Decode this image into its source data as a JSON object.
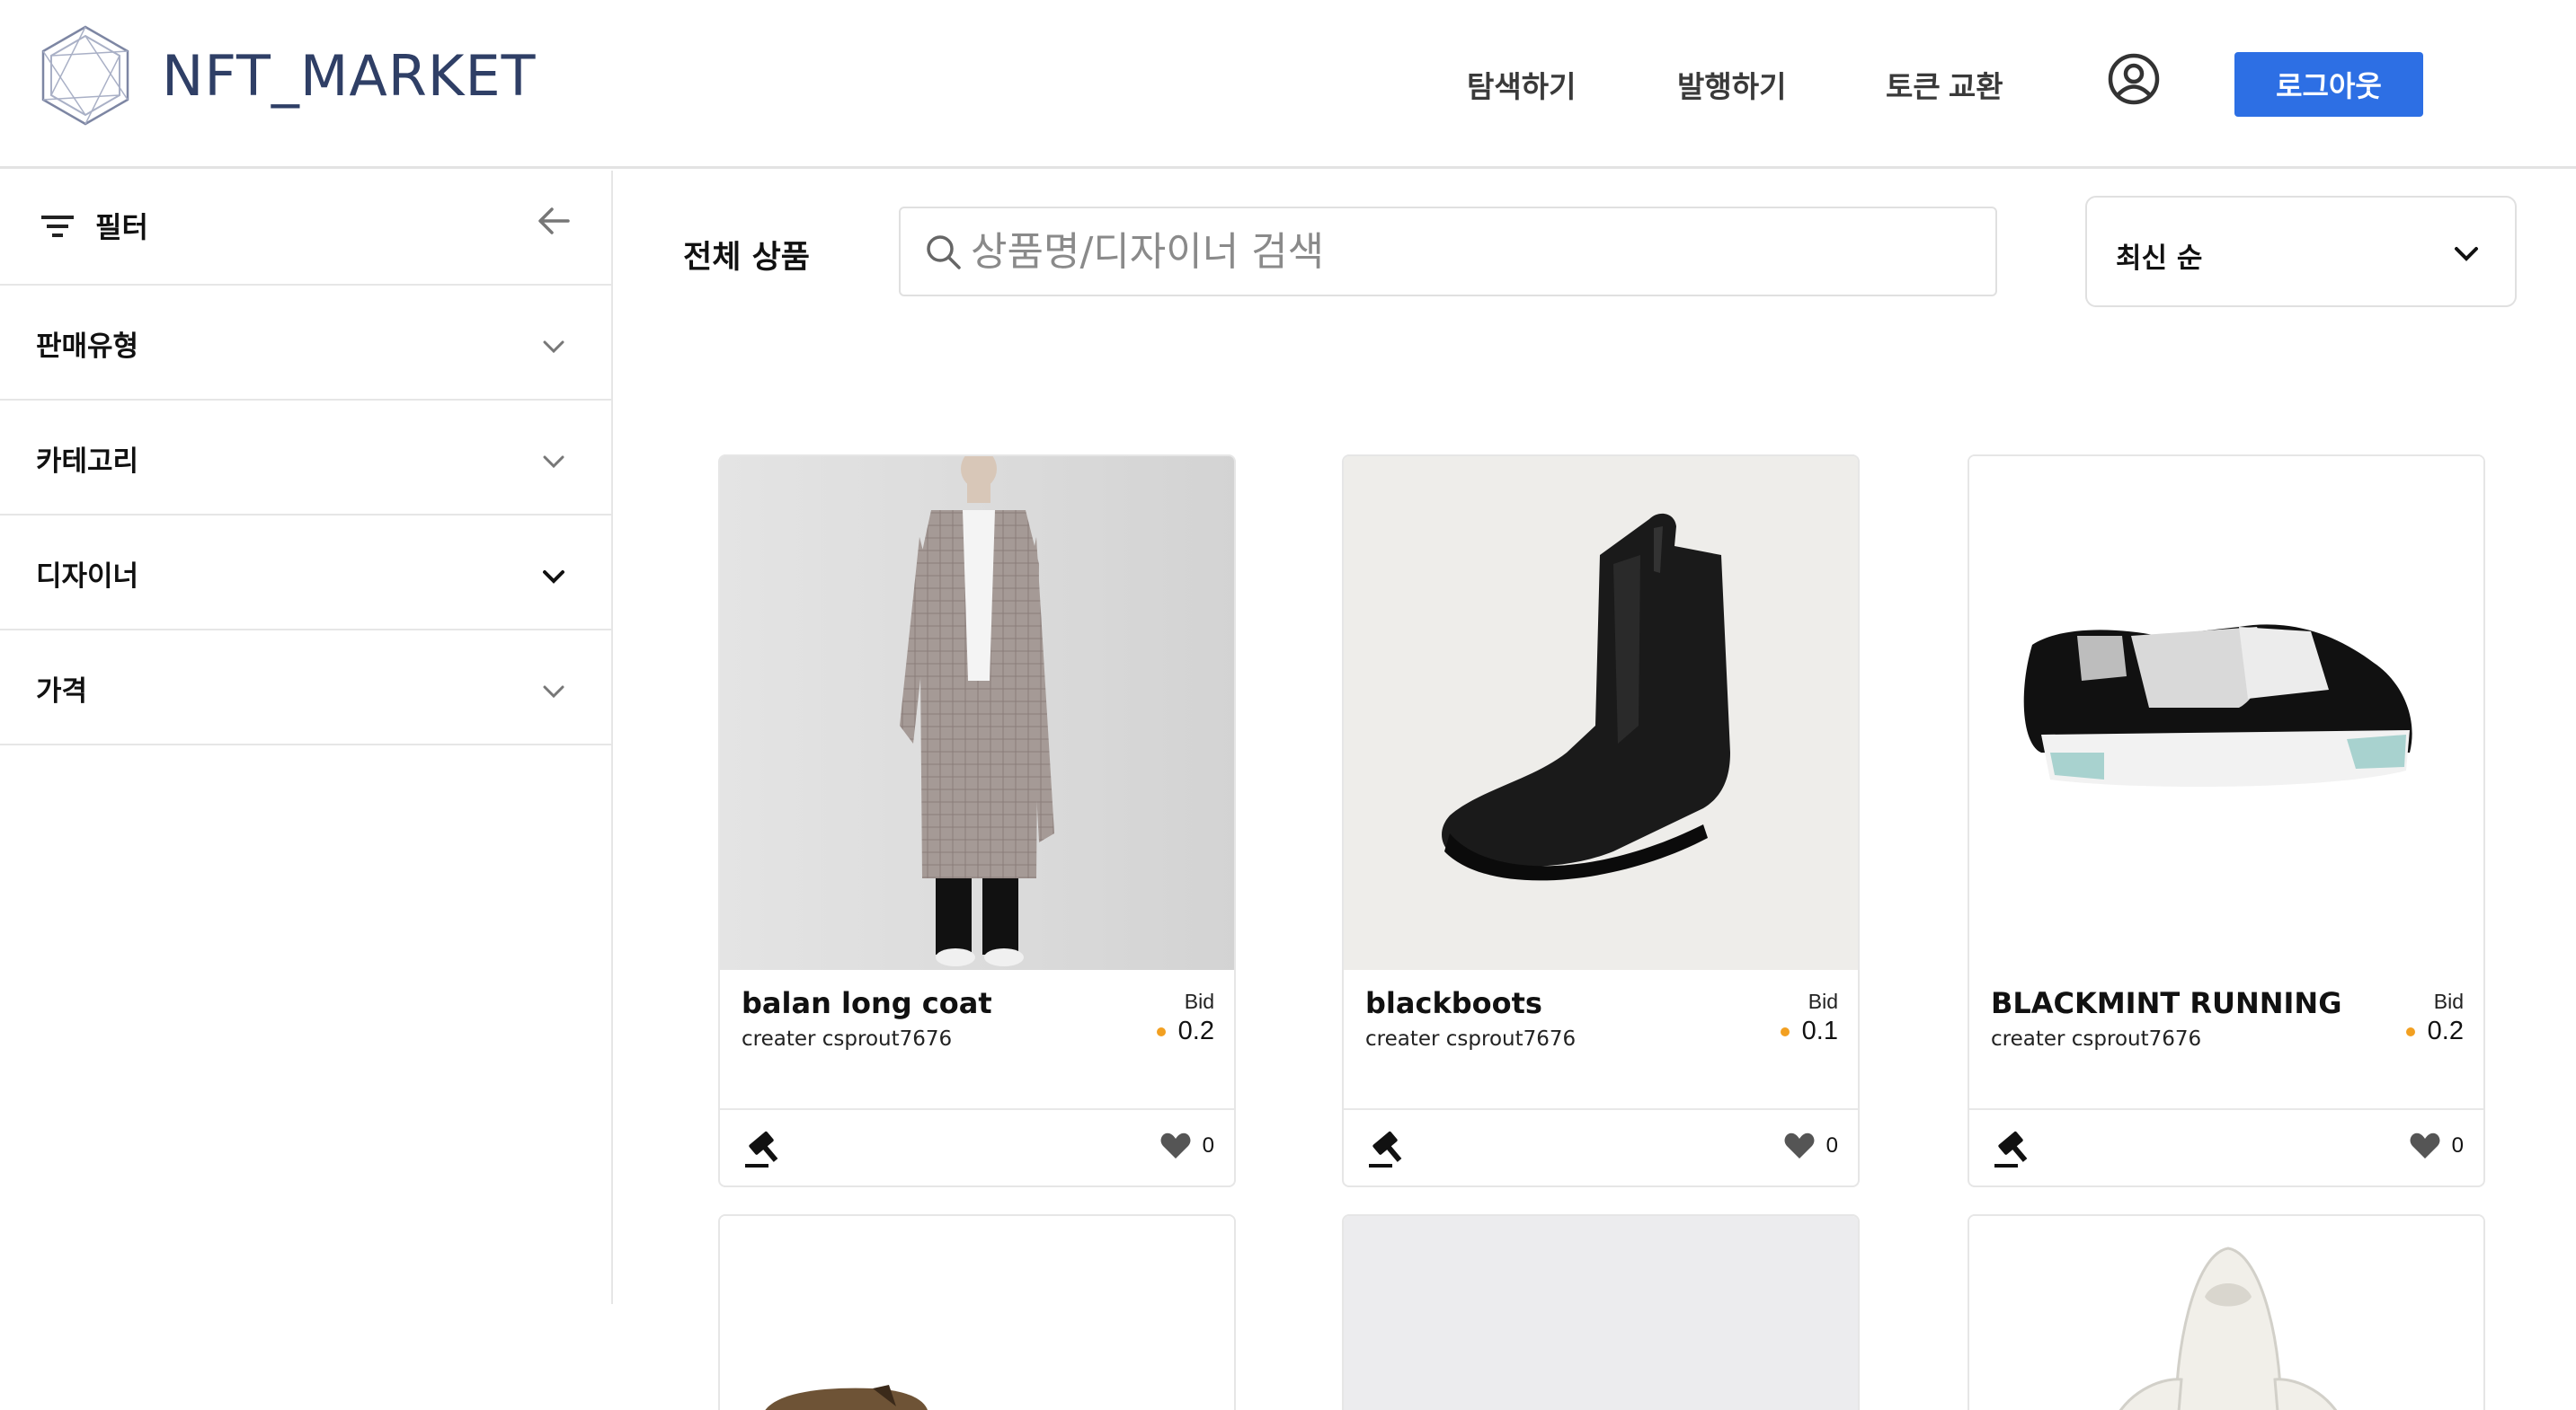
{
  "brand": {
    "name": "NFT_MARKET"
  },
  "nav": {
    "explore": "탐색하기",
    "mint": "발행하기",
    "token_swap": "토큰 교환",
    "logout": "로그아웃"
  },
  "sidebar": {
    "filter_label": "필터",
    "items": [
      {
        "label": "판매유형"
      },
      {
        "label": "카테고리"
      },
      {
        "label": "디자이너"
      },
      {
        "label": "가격"
      }
    ]
  },
  "main": {
    "title": "전체 상품",
    "search_placeholder": "상품명/디자이너 검색",
    "sort_selected": "최신 순"
  },
  "products": [
    {
      "name": "balan long coat",
      "creator": "creater csprout7676",
      "bid_label": "Bid",
      "price": "0.2",
      "likes": "0"
    },
    {
      "name": "blackboots",
      "creator": "creater csprout7676",
      "bid_label": "Bid",
      "price": "0.1",
      "likes": "0"
    },
    {
      "name": "BLACKMINT RUNNING",
      "creator": "creater csprout7676",
      "bid_label": "Bid",
      "price": "0.2",
      "likes": "0"
    }
  ],
  "colors": {
    "accent": "#2d6fe4",
    "coin": "#f2a021",
    "brand_text": "#2f3f66"
  },
  "icons": [
    "logo-hexagon-icon",
    "user-icon",
    "filter-icon",
    "arrow-left-icon",
    "chevron-down-icon",
    "search-icon",
    "gavel-icon",
    "heart-icon"
  ]
}
